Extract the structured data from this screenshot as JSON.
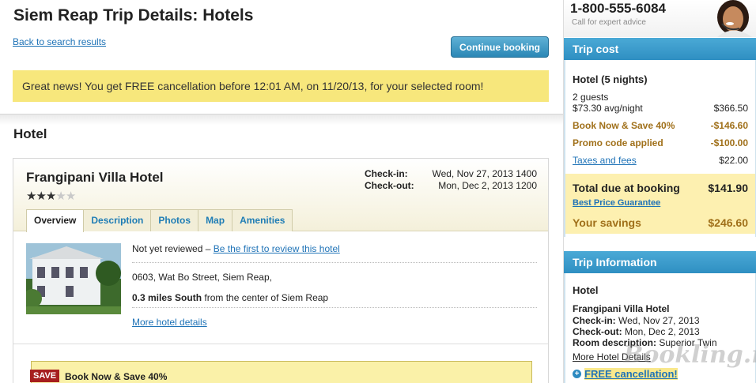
{
  "header": {
    "title": "Siem Reap Trip Details: Hotels",
    "back_link": "Back to search results",
    "continue_button": "Continue booking"
  },
  "banner": {
    "text": "Great news! You get FREE cancellation before 12:01 AM, on 11/20/13, for your selected room!"
  },
  "hotel_section": {
    "title": "Hotel",
    "name": "Frangipani Villa Hotel",
    "stars": 3,
    "max_stars": 5,
    "checkin_label": "Check-in:",
    "checkin_value": "Wed, Nov 27, 2013 1400",
    "checkout_label": "Check-out:",
    "checkout_value": "Mon, Dec 2, 2013 1200",
    "tabs": [
      "Overview",
      "Description",
      "Photos",
      "Map",
      "Amenities"
    ],
    "active_tab": "Overview",
    "review_text": "Not yet reviewed – ",
    "review_link": "Be the first to review this hotel",
    "address": "0603, Wat Bo Street, Siem Reap,",
    "distance_bold": "0.3 miles South",
    "distance_rest": " from the center of Siem Reap",
    "more_details": "More hotel details",
    "deal_tag": "SAVE",
    "deal_text": "Book Now & Save 40%"
  },
  "contact": {
    "phone": "1-800-555-6084",
    "sub": "Call for expert advice"
  },
  "trip_cost": {
    "heading": "Trip cost",
    "title": "Hotel (5 nights)",
    "guests": "2 guests",
    "avg_label": "$73.30 avg/night",
    "avg_total": "$366.50",
    "discount_label": "Book Now & Save 40%",
    "discount_value": "-$146.60",
    "promo_label": "Promo code applied",
    "promo_value": "-$100.00",
    "taxes_label": "Taxes and fees",
    "taxes_value": "$22.00",
    "total_label": "Total due at booking",
    "total_value": "$141.90",
    "guarantee": "Best Price Guarantee",
    "savings_label": "Your savings",
    "savings_value": "$246.60"
  },
  "trip_info": {
    "heading": "Trip Information",
    "title": "Hotel",
    "hotel_name": "Frangipani Villa Hotel",
    "checkin_label": "Check-in:",
    "checkin_value": " Wed, Nov 27, 2013",
    "checkout_label": "Check-out:",
    "checkout_value": " Mon, Dec 2, 2013",
    "room_label": "Room description:",
    "room_value": " Superior Twin",
    "more_details": "More Hotel Details",
    "free_cancel": "FREE cancellation!"
  },
  "watermark": "Bookling.net",
  "colors": {
    "accent_blue": "#2f8fc2",
    "banner_yellow": "#f7e77c",
    "gold": "#a0701a",
    "save_red": "#a61e1e"
  }
}
